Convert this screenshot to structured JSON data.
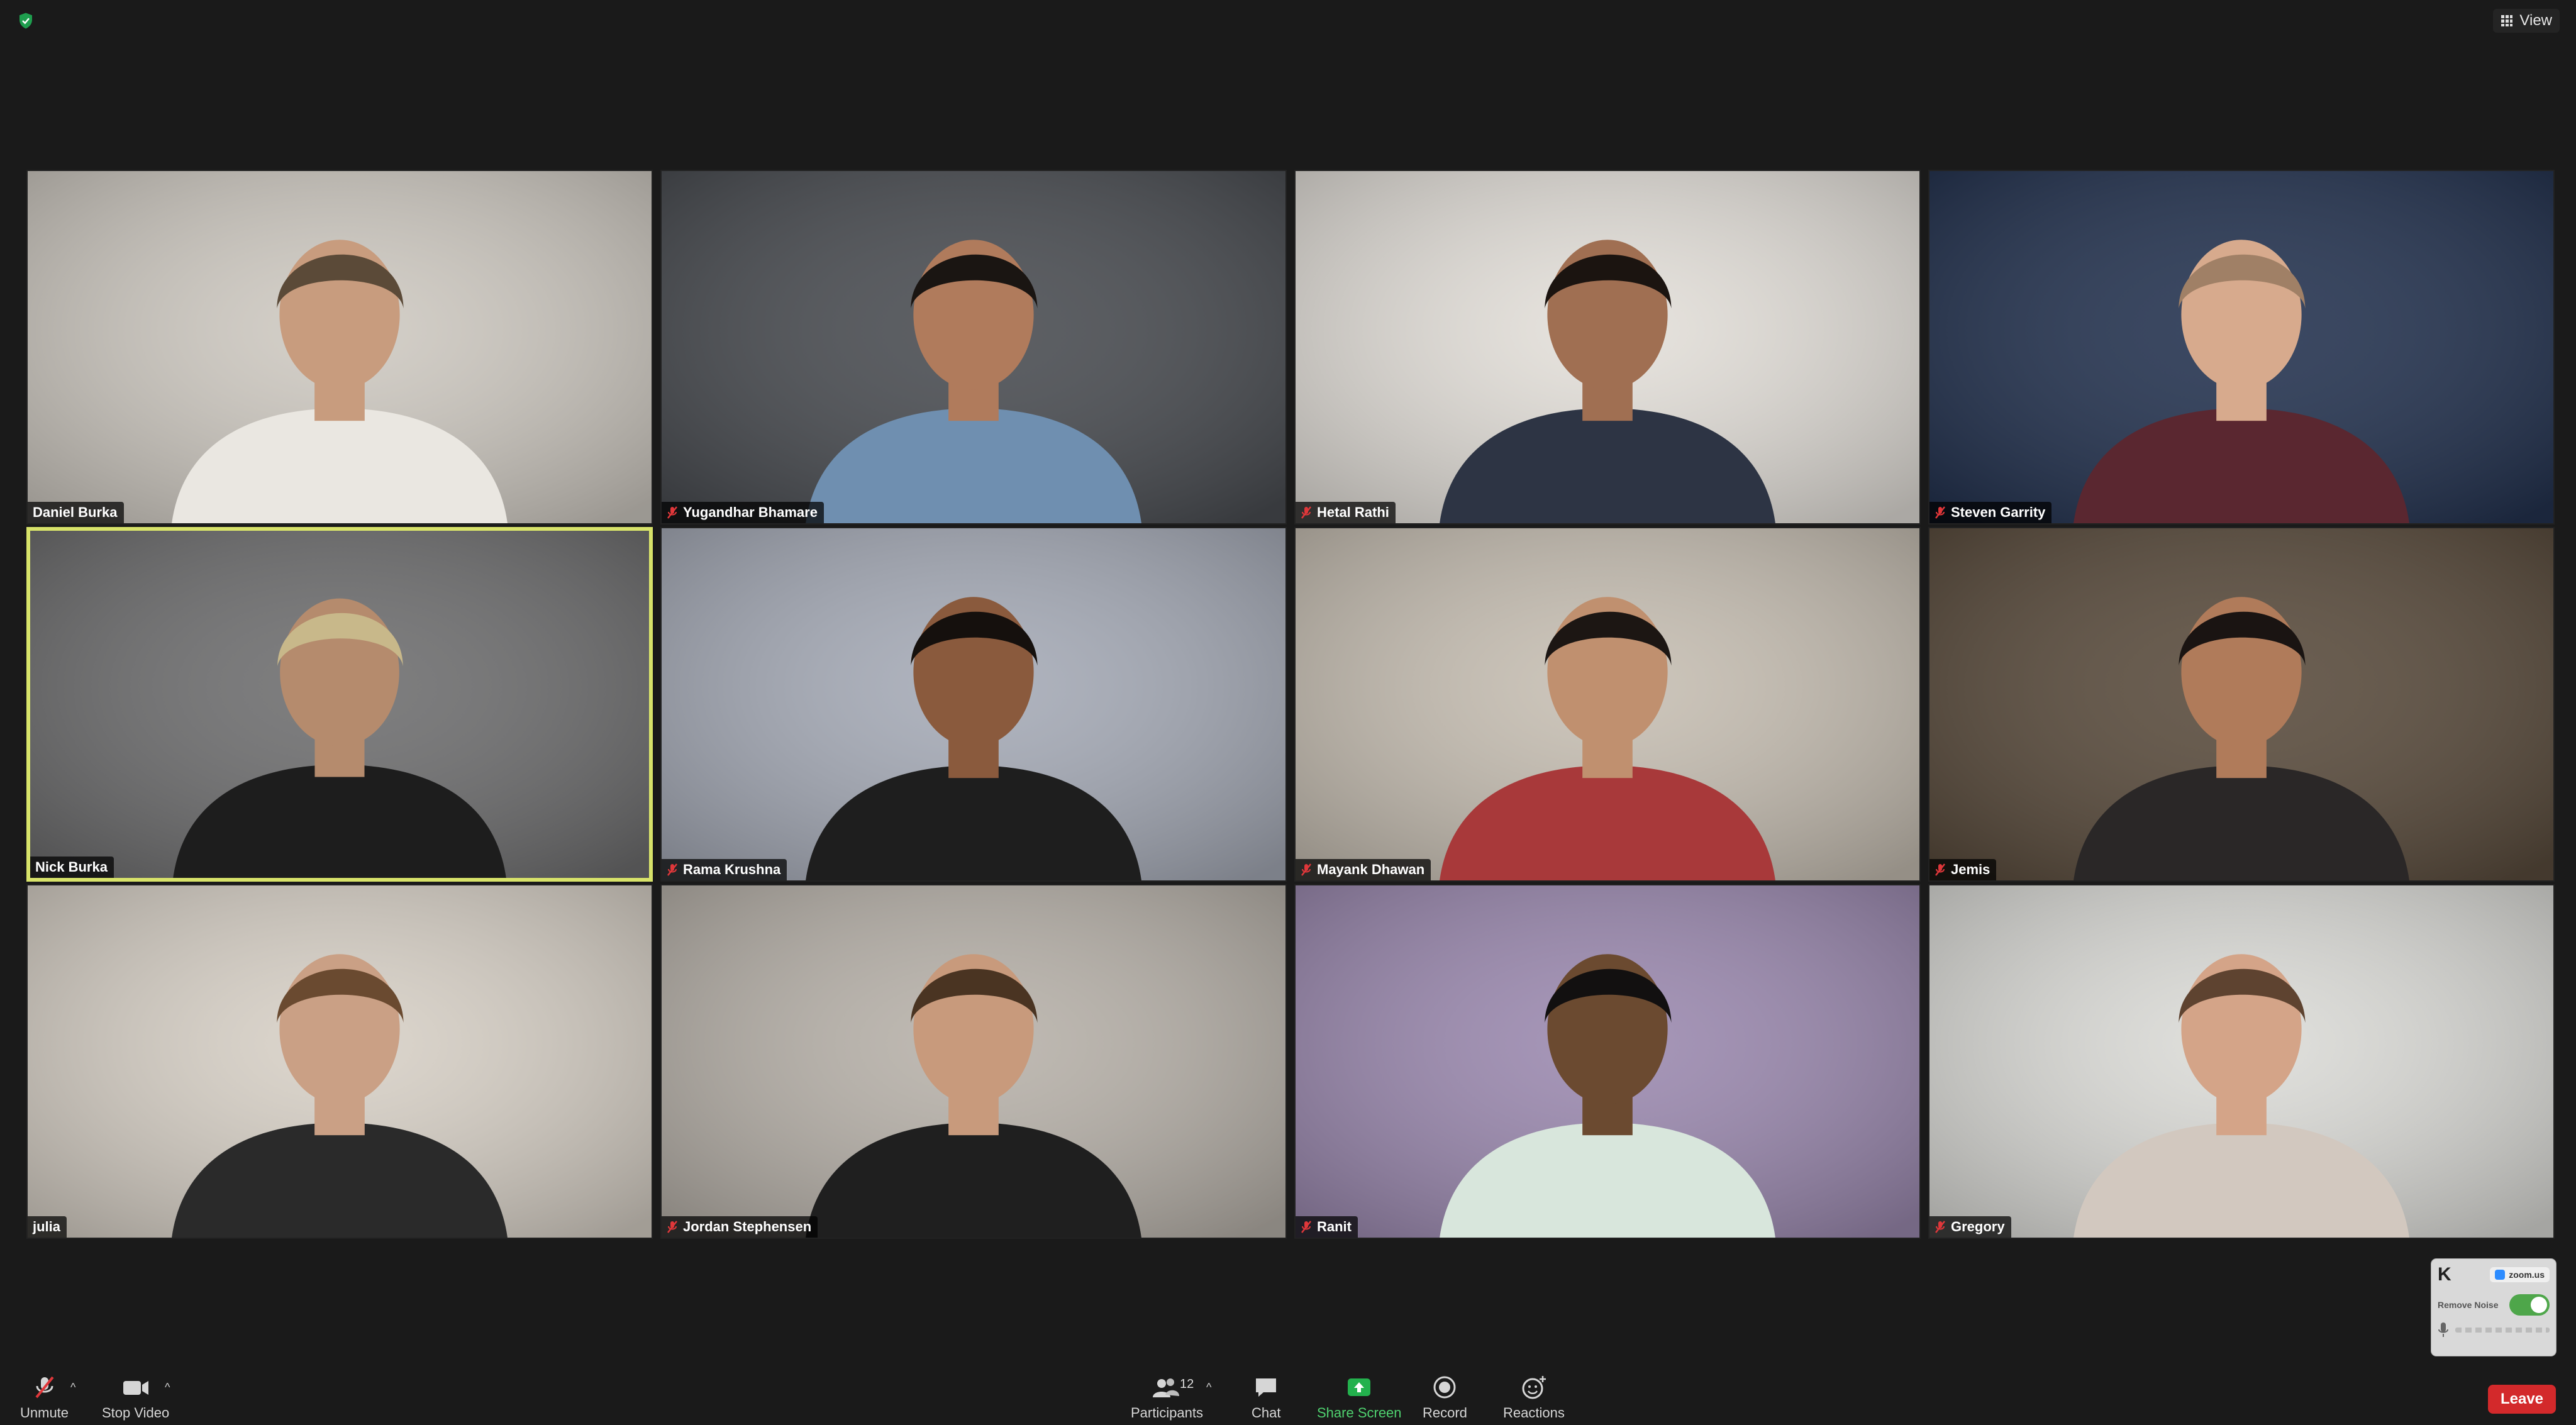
{
  "topbar": {
    "view_label": "View"
  },
  "participants": [
    {
      "name": "Daniel Burka",
      "muted": false,
      "bg": "#cfcac2",
      "skin": "#c89c7e",
      "shirt": "#eae7e1",
      "hair": "#5b4a38"
    },
    {
      "name": "Yugandhar Bhamare",
      "muted": true,
      "bg": "#4a4d52",
      "skin": "#b07b5c",
      "shirt": "#6f8fb0",
      "hair": "#1a1512"
    },
    {
      "name": "Hetal Rathi",
      "muted": true,
      "bg": "#e4e0da",
      "skin": "#a06f52",
      "shirt": "#2d3444",
      "hair": "#1b1410"
    },
    {
      "name": "Steven Garrity",
      "muted": true,
      "bg": "#243350",
      "skin": "#d7aa8d",
      "shirt": "#5a2730",
      "hair": "#a08066"
    },
    {
      "name": "Nick Burka",
      "muted": false,
      "bg": "#6f6f70",
      "skin": "#b58b6d",
      "shirt": "#1d1d1d",
      "hair": "#c8b88a",
      "active": true
    },
    {
      "name": "Rama Krushna",
      "muted": true,
      "bg": "#a6abb7",
      "skin": "#8a5a3d",
      "shirt": "#1e1e1e",
      "hair": "#15100d"
    },
    {
      "name": "Mayank Dhawan",
      "muted": true,
      "bg": "#c7bfb3",
      "skin": "#c0906f",
      "shirt": "#a8393a",
      "hair": "#1c1613"
    },
    {
      "name": "Jemis",
      "muted": true,
      "bg": "#5a4c3d",
      "skin": "#b07b5a",
      "shirt": "#2a2727",
      "hair": "#1a1412"
    },
    {
      "name": "julia",
      "muted": false,
      "bg": "#d8d1c7",
      "skin": "#caa085",
      "shirt": "#2a2a2a",
      "hair": "#6a4a30"
    },
    {
      "name": "Jordan Stephensen",
      "muted": true,
      "bg": "#b8b2aa",
      "skin": "#c89a7c",
      "shirt": "#1f1f1f",
      "hair": "#4a3422"
    },
    {
      "name": "Ranit",
      "muted": true,
      "bg": "#9c8ab0",
      "skin": "#6b4a30",
      "shirt": "#d8e6dc",
      "hair": "#121010"
    },
    {
      "name": "Gregory",
      "muted": true,
      "bg": "#dcdcd8",
      "skin": "#d4a488",
      "shirt": "#d2c8bf",
      "hair": "#5e4330"
    }
  ],
  "noise_widget": {
    "app": "zoom.us",
    "label": "Remove Noise",
    "enabled": true
  },
  "toolbar": {
    "unmute": "Unmute",
    "stop_video": "Stop Video",
    "participants": "Participants",
    "participant_count": "12",
    "chat": "Chat",
    "share_screen": "Share Screen",
    "record": "Record",
    "reactions": "Reactions",
    "leave": "Leave"
  },
  "colors": {
    "active_speaker_border": "#d8e36a",
    "leave_button": "#d3292b",
    "share_green": "#4fd16f"
  }
}
